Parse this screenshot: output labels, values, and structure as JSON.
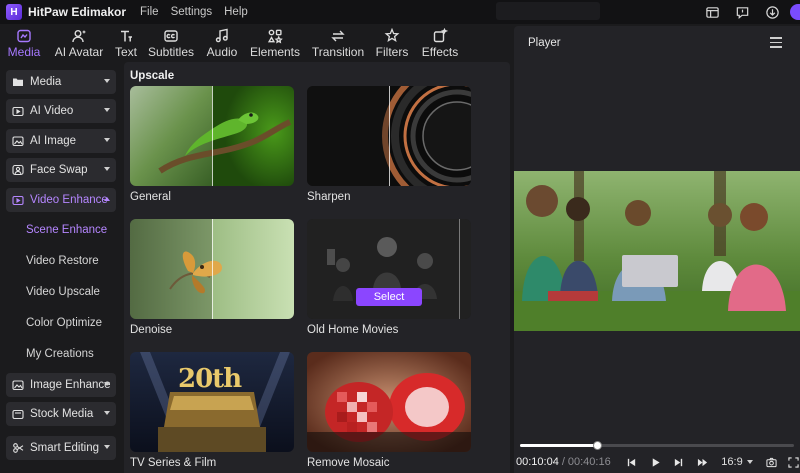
{
  "app": {
    "title": "HitPaw Edimakor",
    "menu": [
      "File",
      "Settings",
      "Help"
    ]
  },
  "toolbar": {
    "tabs": [
      {
        "label": "Media",
        "icon": "media-icon",
        "active": true
      },
      {
        "label": "AI Avatar",
        "icon": "avatar-icon"
      },
      {
        "label": "Text",
        "icon": "text-icon"
      },
      {
        "label": "Subtitles",
        "icon": "subtitles-icon"
      },
      {
        "label": "Audio",
        "icon": "audio-icon"
      },
      {
        "label": "Elements",
        "icon": "elements-icon"
      },
      {
        "label": "Transition",
        "icon": "transition-icon"
      },
      {
        "label": "Filters",
        "icon": "filters-icon"
      },
      {
        "label": "Effects",
        "icon": "effects-icon"
      }
    ]
  },
  "sidebar": {
    "categories": [
      {
        "label": "Media",
        "icon": "folder-icon"
      },
      {
        "label": "AI Video",
        "icon": "ai-video-icon"
      },
      {
        "label": "AI Image",
        "icon": "ai-image-icon"
      },
      {
        "label": "Face Swap",
        "icon": "face-swap-icon"
      },
      {
        "label": "Video Enhance",
        "icon": "video-enhance-icon",
        "open": true
      },
      {
        "label": "Image Enhance",
        "icon": "image-enhance-icon"
      },
      {
        "label": "Stock Media",
        "icon": "stock-media-icon"
      },
      {
        "label": "Smart Editing",
        "icon": "smart-editing-icon"
      }
    ],
    "sub_items": [
      {
        "label": "Scene Enhance",
        "active": true
      },
      {
        "label": "Video Restore"
      },
      {
        "label": "Video Upscale"
      },
      {
        "label": "Color Optimize"
      },
      {
        "label": "My Creations"
      }
    ]
  },
  "content": {
    "section_title": "Upscale",
    "cards": [
      {
        "label": "General"
      },
      {
        "label": "Sharpen"
      },
      {
        "label": "Denoise"
      },
      {
        "label": "Old Home Movies",
        "button": "Select"
      },
      {
        "label": "TV Series & Film",
        "thumb_text": "20th"
      },
      {
        "label": "Remove Mosaic"
      }
    ]
  },
  "player": {
    "title": "Player",
    "current_time": "00:10:04",
    "separator": "/",
    "total_time": "00:40:16",
    "progress": 0.28,
    "aspect_ratio": "16:9"
  },
  "colors": {
    "accent": "#a678ff",
    "select_button": "#8b46ff",
    "panel": "#232327",
    "background": "#1b1b1d"
  }
}
